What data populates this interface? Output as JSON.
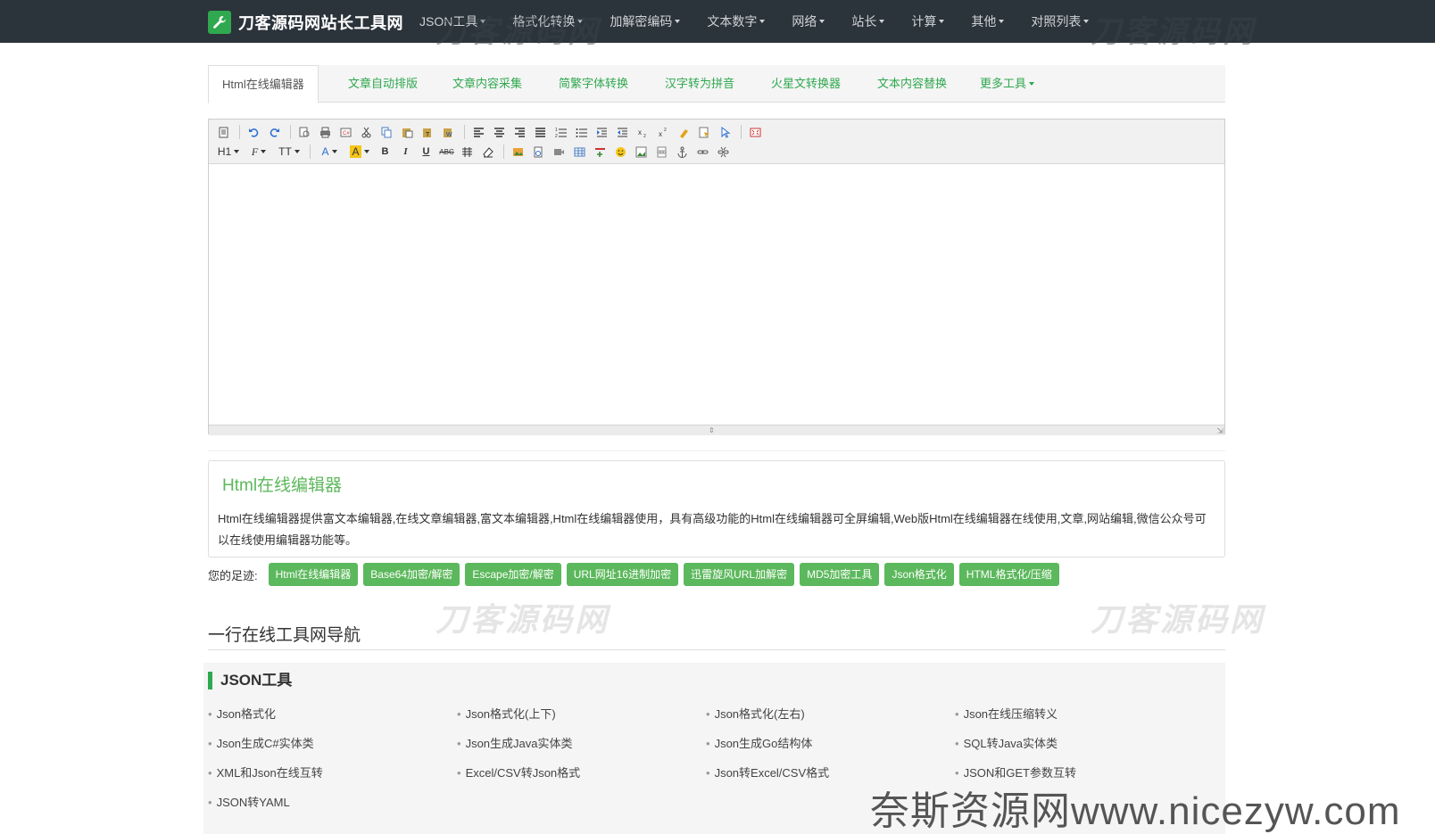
{
  "navbar": {
    "brand": "刀客源码网站长工具网",
    "items": [
      "JSON工具",
      "格式化转换",
      "加解密编码",
      "文本数字",
      "网络",
      "站长",
      "计算",
      "其他",
      "对照列表"
    ]
  },
  "tabs": [
    "Html在线编辑器",
    "文章自动排版",
    "文章内容采集",
    "简繁字体转换",
    "汉字转为拼音",
    "火星文转换器",
    "文本内容替换",
    "更多工具"
  ],
  "editor": {
    "heading_btn": "H1",
    "font_btn": "F",
    "size_btn": "TT",
    "color_btn": "A",
    "bgcolor_btn": "A",
    "bold": "B",
    "italic": "I",
    "underline": "U",
    "strike": "ABC"
  },
  "description": {
    "title": "Html在线编辑器",
    "text": "Html在线编辑器提供富文本编辑器,在线文章编辑器,富文本编辑器,Html在线编辑器使用，具有高级功能的Html在线编辑器可全屏编辑,Web版Html在线编辑器在线使用,文章,网站编辑,微信公众号可以在线使用编辑器功能等。"
  },
  "footprints": {
    "label": "您的足迹:",
    "items": [
      "Html在线编辑器",
      "Base64加密/解密",
      "Escape加密/解密",
      "URL网址16进制加密",
      "迅雷旋风URL加解密",
      "MD5加密工具",
      "Json格式化",
      "HTML格式化/压缩"
    ]
  },
  "watermarks": [
    "刀客源码网",
    "刀客源码网",
    "刀客源码网",
    "刀客源码网"
  ],
  "section": {
    "title": "一行在线工具网导航",
    "category": "JSON工具",
    "items": [
      "Json格式化",
      "Json格式化(上下)",
      "Json格式化(左右)",
      "Json在线压缩转义",
      "Json生成C#实体类",
      "Json生成Java实体类",
      "Json生成Go结构体",
      "SQL转Java实体类",
      "XML和Json在线互转",
      "Excel/CSV转Json格式",
      "Json转Excel/CSV格式",
      "JSON和GET参数互转",
      "JSON转YAML"
    ]
  },
  "corner_watermark": "奈斯资源网www.nicezyw.com",
  "colors": {
    "accent": "#2fa84f",
    "button": "#5cb85c",
    "navbar": "#2b333b"
  }
}
